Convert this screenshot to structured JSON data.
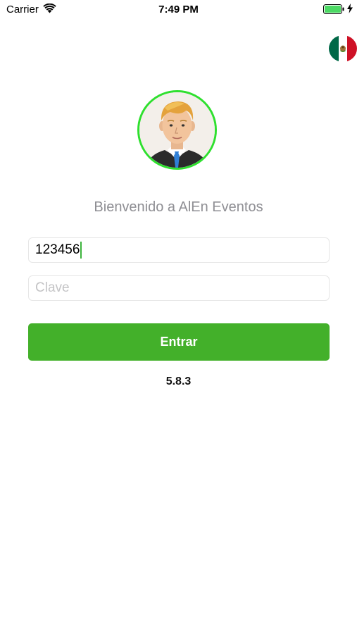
{
  "status_bar": {
    "carrier": "Carrier",
    "time": "7:49 PM",
    "wifi_icon": "wifi-icon",
    "battery_icon": "battery-icon",
    "charging_icon": "charging-bolt-icon",
    "battery_color": "#4cd964"
  },
  "language": {
    "flag_icon": "mexico-flag-icon"
  },
  "login": {
    "avatar_icon": "businessman-avatar",
    "avatar_border_color": "#2ee02e",
    "welcome_text": "Bienvenido a AlEn Eventos",
    "username_value": "123456",
    "password_placeholder": "Clave",
    "enter_label": "Entrar",
    "enter_color": "#43b02a",
    "version": "5.8.3"
  }
}
